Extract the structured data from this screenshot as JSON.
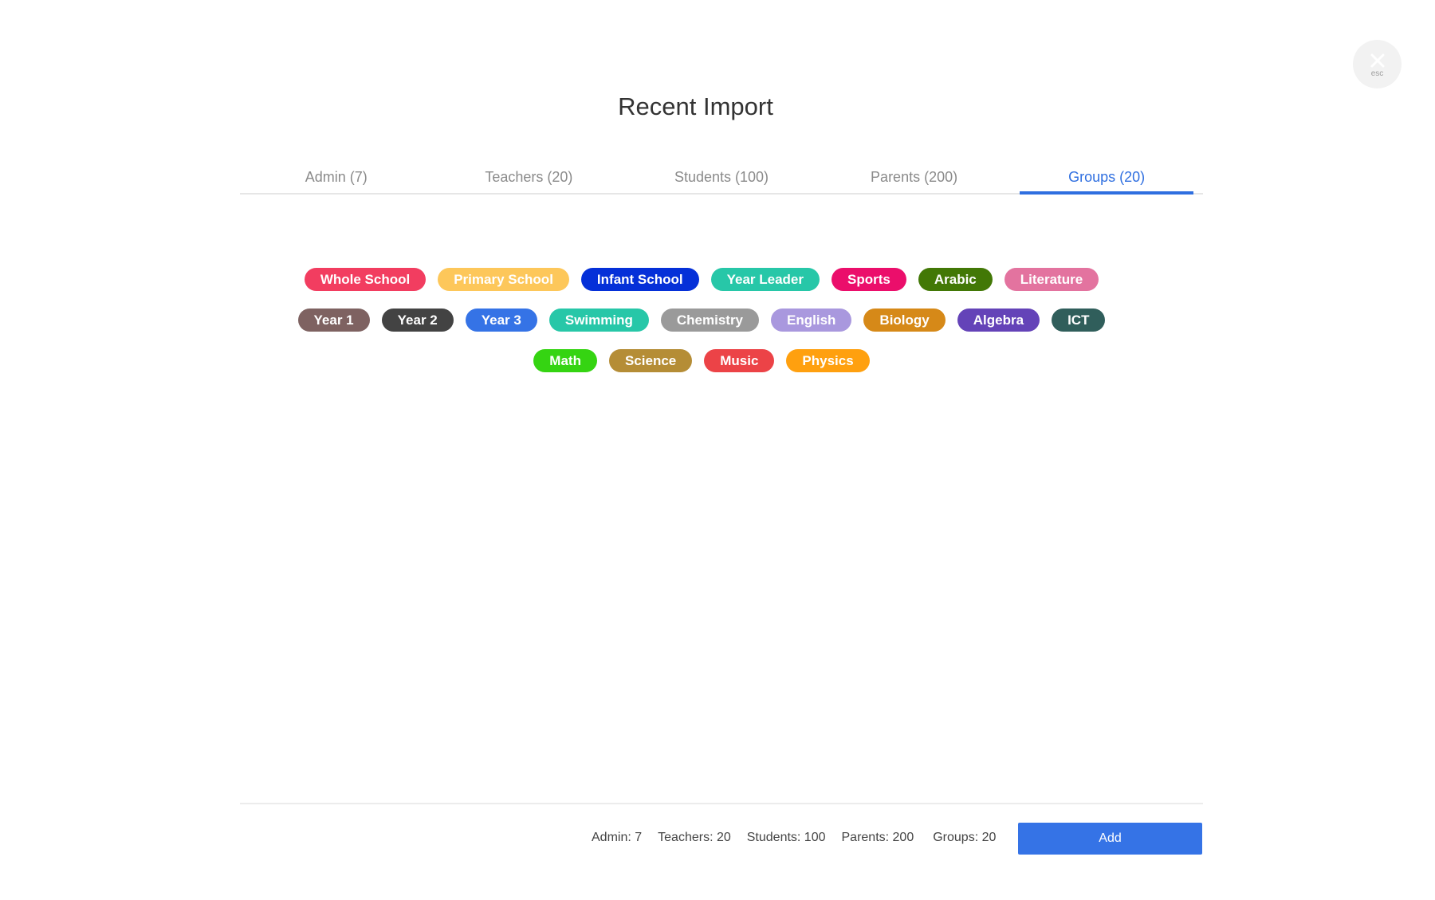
{
  "close": {
    "icon": "close-icon",
    "label": "esc"
  },
  "title": "Recent Import",
  "tabs": [
    {
      "label": "Admin (7)",
      "active": false
    },
    {
      "label": "Teachers (20)",
      "active": false
    },
    {
      "label": "Students (100)",
      "active": false
    },
    {
      "label": "Parents (200)",
      "active": false
    },
    {
      "label": "Groups (20)",
      "active": true
    }
  ],
  "groups": [
    {
      "label": "Whole School",
      "color": "#f23d60"
    },
    {
      "label": "Primary School",
      "color": "#fdc75a"
    },
    {
      "label": "Infant School",
      "color": "#0530d8"
    },
    {
      "label": "Year Leader",
      "color": "#27c7a8"
    },
    {
      "label": "Sports",
      "color": "#eb0e6b"
    },
    {
      "label": "Arabic",
      "color": "#427806"
    },
    {
      "label": "Literature",
      "color": "#e3739f"
    },
    {
      "label": "Year 1",
      "color": "#7e6261"
    },
    {
      "label": "Year 2",
      "color": "#434343"
    },
    {
      "label": "Year 3",
      "color": "#3573e6"
    },
    {
      "label": "Swimming",
      "color": "#27c7a8"
    },
    {
      "label": "Chemistry",
      "color": "#9a9a9a"
    },
    {
      "label": "English",
      "color": "#a998de"
    },
    {
      "label": "Biology",
      "color": "#d68918"
    },
    {
      "label": "Algebra",
      "color": "#6443b8"
    },
    {
      "label": "ICT",
      "color": "#305e5b"
    },
    {
      "label": "Math",
      "color": "#35d412"
    },
    {
      "label": "Science",
      "color": "#b58d36"
    },
    {
      "label": "Music",
      "color": "#ec4347"
    },
    {
      "label": "Physics",
      "color": "#ffa00f"
    }
  ],
  "footer": {
    "stats": {
      "admin": "Admin: 7",
      "teachers": "Teachers: 20",
      "students": "Students: 100",
      "parents": "Parents: 200",
      "groups": "Groups: 20"
    },
    "add_label": "Add"
  }
}
